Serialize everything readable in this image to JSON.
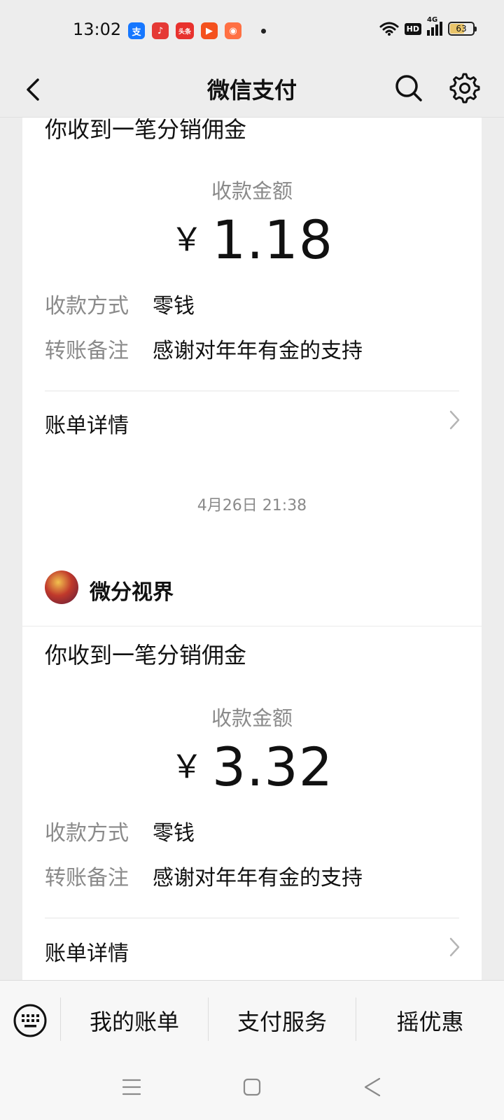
{
  "status_bar": {
    "time": "13:02",
    "network": "4G",
    "hd": "HD",
    "battery": "63",
    "battery_level": 0.63,
    "app_icons": [
      {
        "name": "alipay-icon",
        "glyph": "支",
        "color": "#1677ff"
      },
      {
        "name": "music-icon",
        "glyph": "♪",
        "color": "#e53935"
      },
      {
        "name": "toutiao-icon",
        "glyph": "头条",
        "color": "#e8322e"
      },
      {
        "name": "video-icon",
        "glyph": "▶",
        "color": "#f4511e"
      },
      {
        "name": "shopping-icon",
        "glyph": "◉",
        "color": "#ff7043"
      }
    ]
  },
  "nav": {
    "title": "微信支付",
    "icons": [
      "back-icon",
      "search-icon",
      "gear-icon"
    ]
  },
  "feed": {
    "cards": [
      {
        "title": "你收到一笔分销佣金",
        "amount_label": "收款金额",
        "currency": "￥",
        "amount": "1.18",
        "rows": [
          {
            "label": "收款方式",
            "value": "零钱"
          },
          {
            "label": "转账备注",
            "value": "感谢对年年有金的支持"
          }
        ],
        "bill_link": "账单详情"
      },
      {
        "timestamp": "4月26日 21:38",
        "merchant": "微分视界",
        "title": "你收到一笔分销佣金",
        "amount_label": "收款金额",
        "currency": "￥",
        "amount": "3.32",
        "rows": [
          {
            "label": "收款方式",
            "value": "零钱"
          },
          {
            "label": "转账备注",
            "value": "感谢对年年有金的支持"
          }
        ],
        "bill_link": "账单详情"
      }
    ]
  },
  "bottom_menu": {
    "items": [
      "我的账单",
      "支付服务",
      "摇优惠"
    ],
    "keyboard_icon": "keyboard-icon"
  },
  "system_nav": [
    "menu-icon",
    "home-icon",
    "back-triangle-icon"
  ]
}
